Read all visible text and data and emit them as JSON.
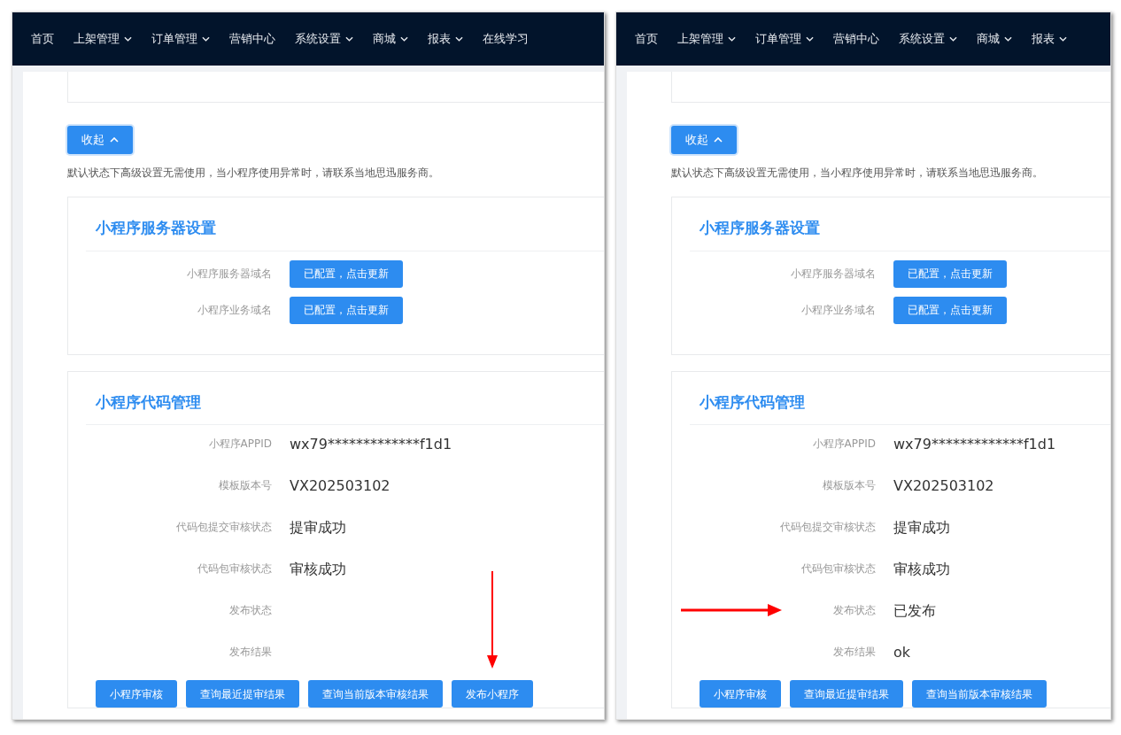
{
  "panels": [
    {
      "nav": [
        {
          "label": "首页",
          "dropdown": false
        },
        {
          "label": "上架管理",
          "dropdown": true
        },
        {
          "label": "订单管理",
          "dropdown": true
        },
        {
          "label": "营销中心",
          "dropdown": false
        },
        {
          "label": "系统设置",
          "dropdown": true
        },
        {
          "label": "商城",
          "dropdown": true
        },
        {
          "label": "报表",
          "dropdown": true
        },
        {
          "label": "在线学习",
          "dropdown": false
        }
      ],
      "collapse_button": "收起",
      "note": "默认状态下高级设置无需使用，当小程序使用异常时，请联系当地思迅服务商。",
      "server_section": {
        "title": "小程序服务器设置",
        "rows": [
          {
            "label": "小程序服务器域名",
            "button": "已配置，点击更新"
          },
          {
            "label": "小程序业务域名",
            "button": "已配置，点击更新"
          }
        ]
      },
      "code_section": {
        "title": "小程序代码管理",
        "rows": [
          {
            "label": "小程序APPID",
            "value": "wx79*************f1d1",
            "marked": false
          },
          {
            "label": "模板版本号",
            "value": "VX202503102",
            "marked": false
          },
          {
            "label": "代码包提交审核状态",
            "value": "提审成功",
            "marked": false
          },
          {
            "label": "代码包审核状态",
            "value": "审核成功",
            "marked": false
          },
          {
            "label": "发布状态",
            "marked": false
          },
          {
            "label": "发布结果",
            "marked": false
          }
        ],
        "buttons": [
          {
            "label": "小程序审核",
            "marked": false
          },
          {
            "label": "查询最近提审结果",
            "marked": false
          },
          {
            "label": "查询当前版本审核结果",
            "marked": false
          },
          {
            "label": "发布小程序",
            "marked": true
          }
        ]
      }
    },
    {
      "nav": [
        {
          "label": "首页",
          "dropdown": false
        },
        {
          "label": "上架管理",
          "dropdown": true
        },
        {
          "label": "订单管理",
          "dropdown": true
        },
        {
          "label": "营销中心",
          "dropdown": false
        },
        {
          "label": "系统设置",
          "dropdown": true
        },
        {
          "label": "商城",
          "dropdown": true
        },
        {
          "label": "报表",
          "dropdown": true
        }
      ],
      "collapse_button": "收起",
      "note": "默认状态下高级设置无需使用，当小程序使用异常时，请联系当地思迅服务商。",
      "server_section": {
        "title": "小程序服务器设置",
        "rows": [
          {
            "label": "小程序服务器域名",
            "button": "已配置，点击更新"
          },
          {
            "label": "小程序业务域名",
            "button": "已配置，点击更新"
          }
        ]
      },
      "code_section": {
        "title": "小程序代码管理",
        "rows": [
          {
            "label": "小程序APPID",
            "value": "wx79*************f1d1",
            "marked": false
          },
          {
            "label": "模板版本号",
            "value": "VX202503102",
            "marked": false
          },
          {
            "label": "代码包提交审核状态",
            "value": "提审成功",
            "marked": false
          },
          {
            "label": "代码包审核状态",
            "value": "审核成功",
            "marked": false
          },
          {
            "label": "发布状态",
            "value": "已发布",
            "marked": true
          },
          {
            "label": "发布结果",
            "value": "ok",
            "marked": false
          }
        ],
        "buttons": [
          {
            "label": "小程序审核",
            "marked": false
          },
          {
            "label": "查询最近提审结果",
            "marked": false
          },
          {
            "label": "查询当前版本审核结果",
            "marked": false
          }
        ]
      }
    }
  ]
}
